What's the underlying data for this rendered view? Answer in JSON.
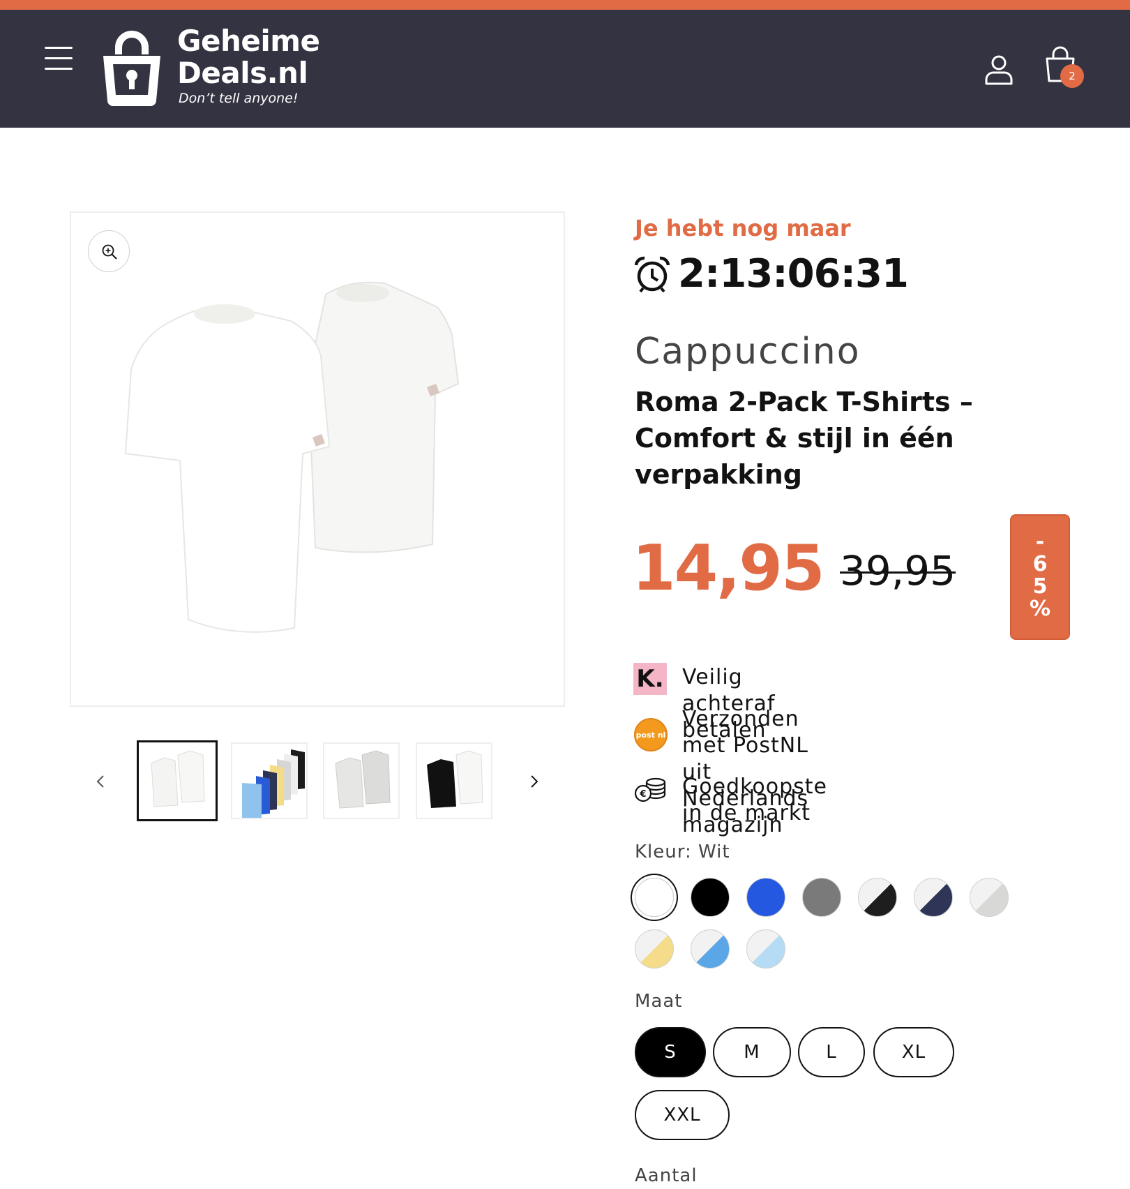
{
  "header": {
    "logo_title": "Geheime\nDeals.nl",
    "logo_tagline": "Don’t tell anyone!",
    "cart_count": "2",
    "accent_color": "#e06b45",
    "bar_color": "#343341"
  },
  "gallery": {
    "thumbnails": [
      {
        "alt": "Witte T-shirts 2-pack",
        "active": true
      },
      {
        "alt": "Kleurenoverzicht T-shirts",
        "active": false
      },
      {
        "alt": "Grijze T-shirts",
        "active": false
      },
      {
        "alt": "Zwart en wit T-shirt",
        "active": false
      }
    ]
  },
  "countdown": {
    "label": "Je hebt nog maar",
    "value": "2:13:06:31"
  },
  "product": {
    "brand": "Cappuccino",
    "title": "Roma 2-Pack T-Shirts – Comfort & stijl in één verpakking",
    "price_sale": "14,95",
    "price_old": "39,95",
    "discount": "-\n6\n5\n%"
  },
  "usps": {
    "klarna_logo": "K.",
    "klarna": "Veilig achteraf betalen",
    "postnl_logo": "post nl",
    "postnl": "Verzonden met PostNL uit\nNederlands magazijn",
    "cheapest": "Goedkoopste in de markt"
  },
  "color": {
    "label": "Kleur: Wit",
    "swatches": [
      {
        "name": "Wit",
        "colors": [
          "#ffffff",
          "#ffffff"
        ],
        "selected": true
      },
      {
        "name": "Zwart",
        "colors": [
          "#000000",
          "#000000"
        ]
      },
      {
        "name": "Blauw",
        "colors": [
          "#2558e0",
          "#2558e0"
        ]
      },
      {
        "name": "Grijs",
        "colors": [
          "#7a7a7a",
          "#7a7a7a"
        ]
      },
      {
        "name": "Wit/Zwart",
        "colors": [
          "#f2f2f2",
          "#1e1e1e"
        ]
      },
      {
        "name": "Wit/Navy",
        "colors": [
          "#f2f2f2",
          "#2f3557"
        ]
      },
      {
        "name": "Wit/Lichtgrijs",
        "colors": [
          "#f2f2f2",
          "#d8d8d6"
        ]
      },
      {
        "name": "Wit/Geel",
        "colors": [
          "#f2f2f2",
          "#f4dc8a"
        ]
      },
      {
        "name": "Wit/Lichtblauw",
        "colors": [
          "#f2f2f2",
          "#5aa6e6"
        ]
      },
      {
        "name": "Wit/IJsblauw",
        "colors": [
          "#f2f2f2",
          "#b5dcf4"
        ]
      }
    ]
  },
  "size": {
    "label": "Maat",
    "options": [
      "S",
      "M",
      "L",
      "XL",
      "XXL"
    ],
    "selected": "S"
  },
  "quantity": {
    "label": "Aantal"
  }
}
